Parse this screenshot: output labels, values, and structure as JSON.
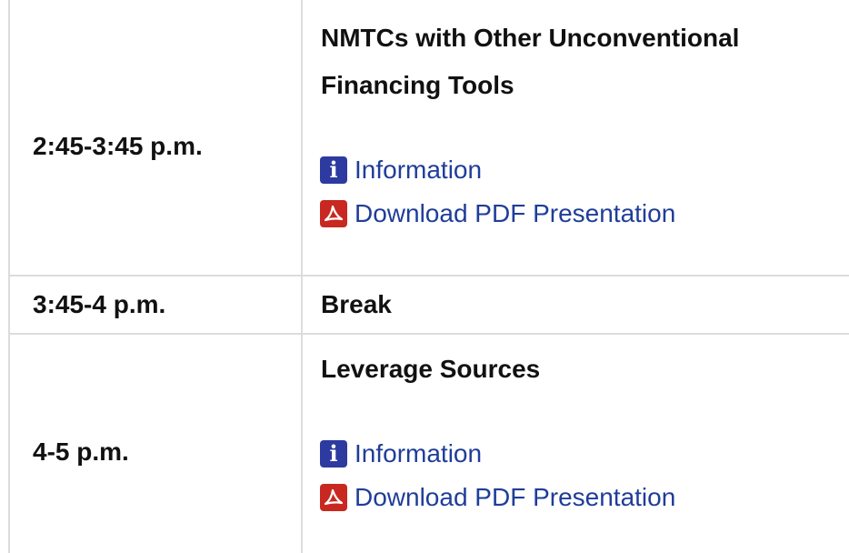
{
  "agenda": [
    {
      "time": "2:45-3:45 p.m.",
      "title_lines": [
        "NMTCs with Other Unconventional",
        "Financing Tools"
      ],
      "links": [
        {
          "icon": "info-icon",
          "label": "Information"
        },
        {
          "icon": "pdf-icon",
          "label": "Download PDF Presentation"
        }
      ]
    },
    {
      "time": "3:45-4 p.m.",
      "title_lines": [
        "Break"
      ],
      "links": []
    },
    {
      "time": "4-5 p.m.",
      "title_lines": [
        "Leverage Sources"
      ],
      "links": [
        {
          "icon": "info-icon",
          "label": "Information"
        },
        {
          "icon": "pdf-icon",
          "label": "Download PDF Presentation"
        }
      ]
    }
  ],
  "icons": {
    "info_glyph": "i",
    "info_color": "#2d3aa0",
    "pdf_color": "#c8281f",
    "link_color": "#1f3d99"
  }
}
